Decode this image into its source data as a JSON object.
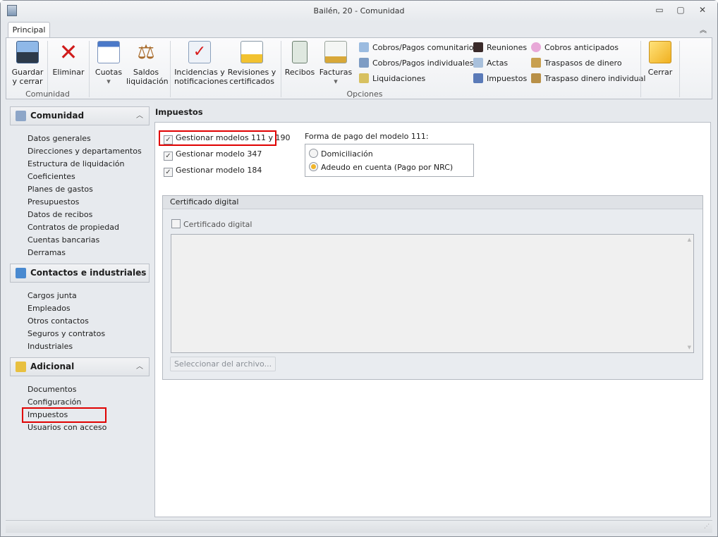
{
  "window": {
    "title": "Bailén, 20 - Comunidad",
    "app_icon": "building-icon",
    "minimize": "▭",
    "restore": "▢",
    "close": "✕",
    "collapse": "︽"
  },
  "ribbon": {
    "tabs": [
      {
        "label": "Principal",
        "active": true
      }
    ],
    "groups": [
      {
        "label": "Comunidad"
      },
      {
        "label": "Opciones"
      }
    ],
    "buttons": {
      "guardar": {
        "l1": "Guardar",
        "l2": "y cerrar",
        "icon": "floppy-disk-icon"
      },
      "eliminar": {
        "l1": "Eliminar",
        "icon": "red-x-icon"
      },
      "cuotas": {
        "l1": "Cuotas",
        "l2": "▾",
        "icon": "calendar-coins-icon"
      },
      "saldos": {
        "l1": "Saldos",
        "l2": "liquidación",
        "icon": "scales-icon"
      },
      "incidencias": {
        "l1": "Incidencias y",
        "l2": "notificaciones",
        "icon": "clipboard-check-icon"
      },
      "revisiones": {
        "l1": "Revisiones y",
        "l2": "certificados",
        "icon": "notebook-bell-icon"
      },
      "recibos": {
        "l1": "Recibos",
        "icon": "receipt-icon"
      },
      "facturas": {
        "l1": "Facturas",
        "l2": "▾",
        "icon": "invoice-coins-icon"
      },
      "cerrar": {
        "l1": "Cerrar",
        "icon": "folder-arrow-icon"
      }
    },
    "small": [
      {
        "label": "Cobros/Pagos comunitarios",
        "icon": "calculator-icon"
      },
      {
        "label": "Cobros/Pagos individuales",
        "icon": "calculator-person-icon"
      },
      {
        "label": "Liquidaciones",
        "icon": "document-coin-icon"
      },
      {
        "label": "Reuniones",
        "icon": "people-icon"
      },
      {
        "label": "Actas",
        "icon": "certificate-icon"
      },
      {
        "label": "Impuestos",
        "icon": "tax-icon"
      },
      {
        "label": "Cobros anticipados",
        "icon": "piggy-bank-icon"
      },
      {
        "label": "Traspasos de dinero",
        "icon": "transfer-icon"
      },
      {
        "label": "Traspaso dinero individual",
        "icon": "transfer-person-icon"
      }
    ]
  },
  "sidebar": {
    "sections": [
      {
        "title": "Comunidad",
        "icon": "building-icon",
        "items": [
          "Datos generales",
          "Direcciones y departamentos",
          "Estructura de liquidación",
          "Coeficientes",
          "Planes de gastos",
          "Presupuestos",
          "Datos de recibos",
          "Contratos de propiedad",
          "Cuentas bancarias",
          "Derramas"
        ]
      },
      {
        "title": "Contactos e industriales",
        "icon": "contacts-icon",
        "items": [
          "Cargos junta",
          "Empleados",
          "Otros contactos",
          "Seguros y contratos",
          "Industriales"
        ]
      },
      {
        "title": "Adicional",
        "icon": "database-icon",
        "items": [
          "Documentos",
          "Configuración",
          "Impuestos",
          "Usuarios con acceso"
        ]
      }
    ],
    "selected": "Impuestos"
  },
  "main": {
    "title": "Impuestos",
    "checks": [
      {
        "label": "Gestionar modelos 111 y 190",
        "checked": true
      },
      {
        "label": "Gestionar modelo 347",
        "checked": true
      },
      {
        "label": "Gestionar modelo 184",
        "checked": true
      }
    ],
    "forma_pago": {
      "label": "Forma de pago del modelo 111:",
      "options": [
        {
          "label": "Domiciliación",
          "selected": false
        },
        {
          "label": "Adeudo en cuenta (Pago por NRC)",
          "selected": true
        }
      ]
    },
    "certificado": {
      "group_title": "Certificado digital",
      "check_label": "Certificado digital",
      "checked": false,
      "button": "Seleccionar del archivo..."
    }
  },
  "colors": {
    "highlight": "#e00000",
    "radio_selected": "#f0b52a"
  }
}
